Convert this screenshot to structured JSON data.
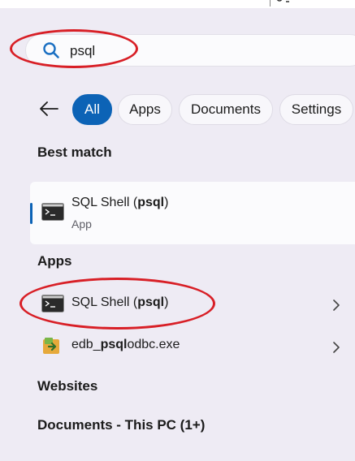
{
  "search": {
    "query": "psql"
  },
  "filters": {
    "tabs": [
      {
        "label": "All",
        "active": true
      },
      {
        "label": "Apps",
        "active": false
      },
      {
        "label": "Documents",
        "active": false
      },
      {
        "label": "Settings",
        "active": false
      }
    ]
  },
  "best_match": {
    "header": "Best match",
    "title_prefix": "SQL Shell (",
    "title_bold": "psql",
    "title_suffix": ")",
    "subtitle": "App",
    "icon": "terminal-icon"
  },
  "apps": {
    "header": "Apps",
    "items": [
      {
        "title_prefix": "SQL Shell (",
        "title_bold": "psql",
        "title_suffix": ")",
        "icon": "terminal-icon"
      },
      {
        "title_prefix": "edb_",
        "title_bold": "psql",
        "title_suffix": "odbc.exe",
        "icon": "installer-icon"
      }
    ]
  },
  "websites": {
    "header": "Websites"
  },
  "documents": {
    "header": "Documents - This PC (1+)"
  },
  "colors": {
    "accent": "#0c63b6",
    "annotation": "#d81f26",
    "panel": "#eeebf4"
  }
}
